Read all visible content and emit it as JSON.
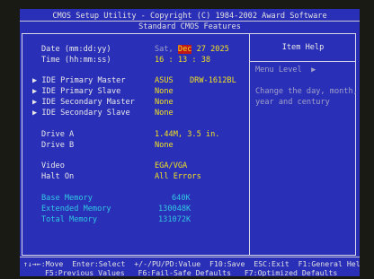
{
  "header": {
    "title": "CMOS Setup Utility - Copyright (C) 1984-2002 Award Software",
    "subtitle": "Standard CMOS Features"
  },
  "fields": {
    "date_label": "Date (mm:dd:yy)",
    "date_day": "Sat,",
    "date_month": "Dec",
    "date_rest": "27 2025",
    "time_label": "Time (hh:mm:ss)",
    "time_value": "16 : 13 : 38",
    "ide_pm_label": "IDE Primary Master",
    "ide_pm_value": "ASUS",
    "ide_pm_value2": "DRW-1612BL",
    "ide_ps_label": "IDE Primary Slave",
    "ide_ps_value": "None",
    "ide_sm_label": "IDE Secondary Master",
    "ide_sm_value": "None",
    "ide_ss_label": "IDE Secondary Slave",
    "ide_ss_value": "None",
    "drive_a_label": "Drive A",
    "drive_a_value": "1.44M, 3.5 in.",
    "drive_b_label": "Drive B",
    "drive_b_value": "None",
    "video_label": "Video",
    "video_value": "EGA/VGA",
    "halt_label": "Halt On",
    "halt_value": "All Errors",
    "base_mem_label": "Base Memory",
    "base_mem_value": "640K",
    "ext_mem_label": "Extended Memory",
    "ext_mem_value": "130048K",
    "total_mem_label": "Total Memory",
    "total_mem_value": "131072K"
  },
  "help": {
    "title": "Item Help",
    "menu_level": "Menu Level",
    "menu_arrow": "▶",
    "text_line1": "Change the day, month,",
    "text_line2": "year and century"
  },
  "arrow_glyph": "▶",
  "footer": {
    "line1": "↑↓→←:Move  Enter:Select  +/-/PU/PD:Value  F10:Save  ESC:Exit  F1:General Help",
    "line2": "F5:Previous Values   F6:Fail-Safe Defaults   F7:Optimized Defaults"
  },
  "colors": {
    "background": "#2a2fb8",
    "value_yellow": "#f0e020",
    "memory_cyan": "#30c8e0",
    "selected_red": "#c01818"
  }
}
